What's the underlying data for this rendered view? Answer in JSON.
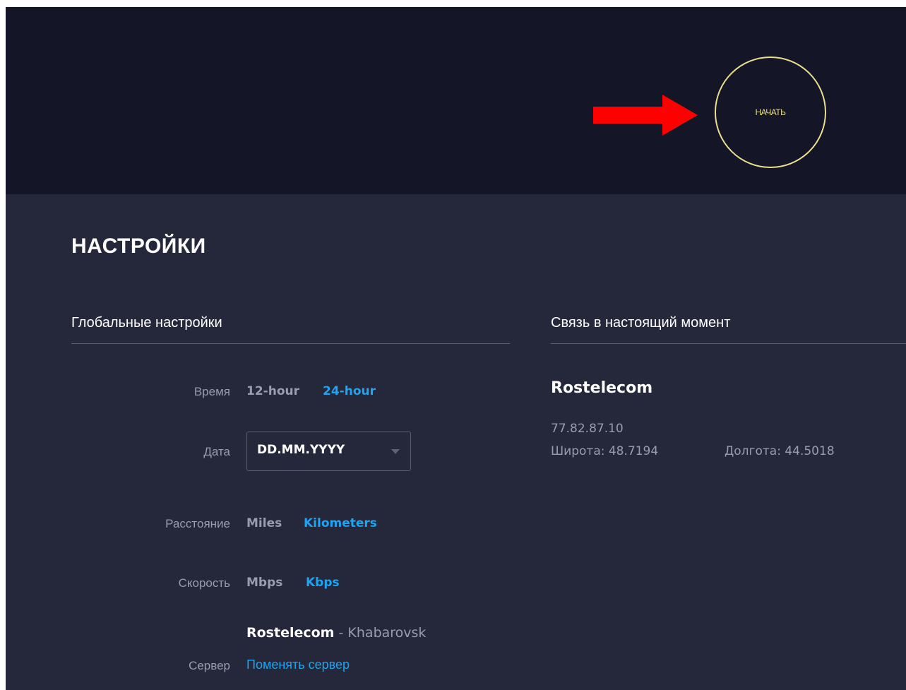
{
  "hero": {
    "start_button": "НАЧАТЬ"
  },
  "settings": {
    "title": "НАСТРОЙКИ",
    "global": {
      "heading": "Глобальные настройки",
      "time": {
        "label": "Время",
        "options": [
          "12-hour",
          "24-hour"
        ],
        "selected": "24-hour"
      },
      "date": {
        "label": "Дата",
        "value": "DD.MM.YYYY"
      },
      "distance": {
        "label": "Расстояние",
        "options": [
          "Miles",
          "Kilometers"
        ],
        "selected": "Kilometers"
      },
      "speed": {
        "label": "Скорость",
        "options": [
          "Mbps",
          "Kbps"
        ],
        "selected": "Kbps"
      },
      "server": {
        "label": "Сервер",
        "isp": "Rostelecom",
        "separator": " - ",
        "city": "Khabarovsk",
        "change_link": "Поменять сервер"
      }
    },
    "connection": {
      "heading": "Связь в настоящий момент",
      "isp": "Rostelecom",
      "ip": "77.82.87.10",
      "latitude": "Широта: 48.7194",
      "longitude": "Долгота: 44.5018"
    }
  },
  "colors": {
    "hero_bg": "#141526",
    "panel_bg": "#25273a",
    "accent_blue": "#1ea4f1",
    "start_ring": "#eadf8a",
    "arrow_red": "#ff0000"
  },
  "icons": {
    "arrow": "right-arrow-icon",
    "dropdown": "chevron-down-icon"
  }
}
